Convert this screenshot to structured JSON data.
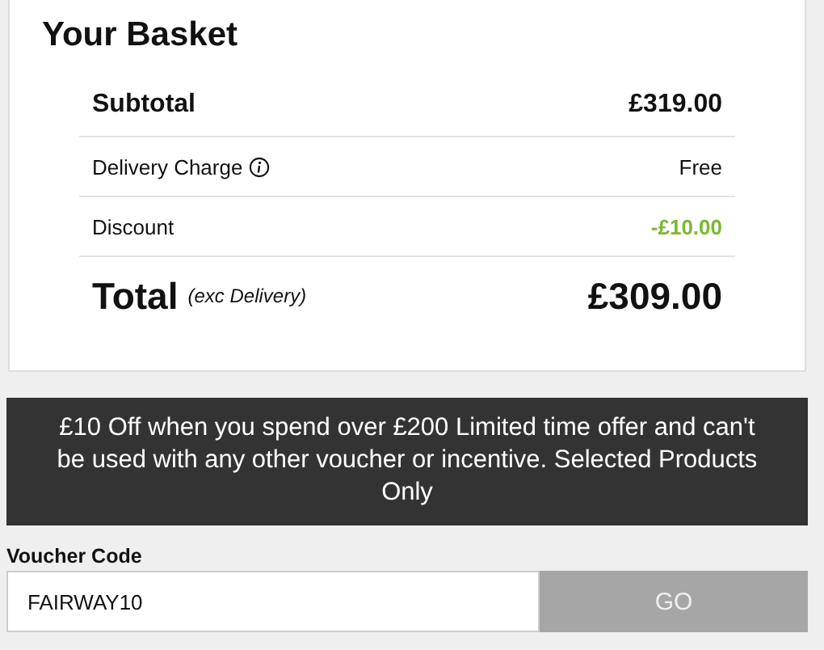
{
  "basket": {
    "title": "Your Basket",
    "rows": [
      {
        "kind": "subtotal",
        "label": "Subtotal",
        "value": "£319.00"
      },
      {
        "kind": "line",
        "label": "Delivery Charge",
        "info": true,
        "value": "Free"
      },
      {
        "kind": "discount",
        "label": "Discount",
        "value": "-£10.00"
      },
      {
        "kind": "total",
        "label": "Total",
        "note": "(exc Delivery)",
        "value": "£309.00"
      }
    ]
  },
  "offer": {
    "text": "£10 Off when you spend over £200 Limited time offer and can't be used with any other voucher or incentive. Selected Products Only"
  },
  "voucher": {
    "label": "Voucher Code",
    "value": "FAIRWAY10",
    "button": "GO"
  }
}
